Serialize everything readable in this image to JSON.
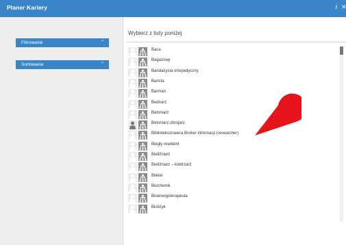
{
  "window": {
    "title": "Planer Kariery",
    "info_glyph": "i",
    "close_glyph": "✕"
  },
  "sidebar": {
    "panels": [
      {
        "label": "Filtrowanie",
        "chevron": "⌃"
      },
      {
        "label": "Sortowanie",
        "chevron": "⌃"
      }
    ]
  },
  "main": {
    "heading": "Wybierz z listy poniżej",
    "jobs": [
      {
        "label": "Baca",
        "highlighted_icon": false
      },
      {
        "label": "Bagażowy",
        "highlighted_icon": false
      },
      {
        "label": "Bandażysta ortopedyczny",
        "highlighted_icon": false
      },
      {
        "label": "Barista",
        "highlighted_icon": false
      },
      {
        "label": "Barman",
        "highlighted_icon": false
      },
      {
        "label": "Bednarz",
        "highlighted_icon": false
      },
      {
        "label": "Betoniarz",
        "highlighted_icon": false
      },
      {
        "label": "Betoniarz-zbrojarz",
        "highlighted_icon": true
      },
      {
        "label": "Bibliotekoznawca Broker informacji (researcher)",
        "highlighted_icon": false
      },
      {
        "label": "Biegły rewident",
        "highlighted_icon": false
      },
      {
        "label": "Bieliźniarz",
        "highlighted_icon": false
      },
      {
        "label": "Bieliźniarz – kołdrzarz",
        "highlighted_icon": false
      },
      {
        "label": "Bileter",
        "highlighted_icon": false
      },
      {
        "label": "Biochemik",
        "highlighted_icon": false
      },
      {
        "label": "Bioenergoterapeuta",
        "highlighted_icon": false
      },
      {
        "label": "Biofizyk",
        "highlighted_icon": false
      }
    ]
  },
  "colors": {
    "titlebar": "#3a86c8",
    "panel_button": "#3a86c8",
    "pin_annotation": "#e8141b"
  },
  "icons": [
    "info-icon",
    "close-icon",
    "chevron-up-icon",
    "person-icon",
    "organization-icon",
    "map-pin-icon"
  ]
}
